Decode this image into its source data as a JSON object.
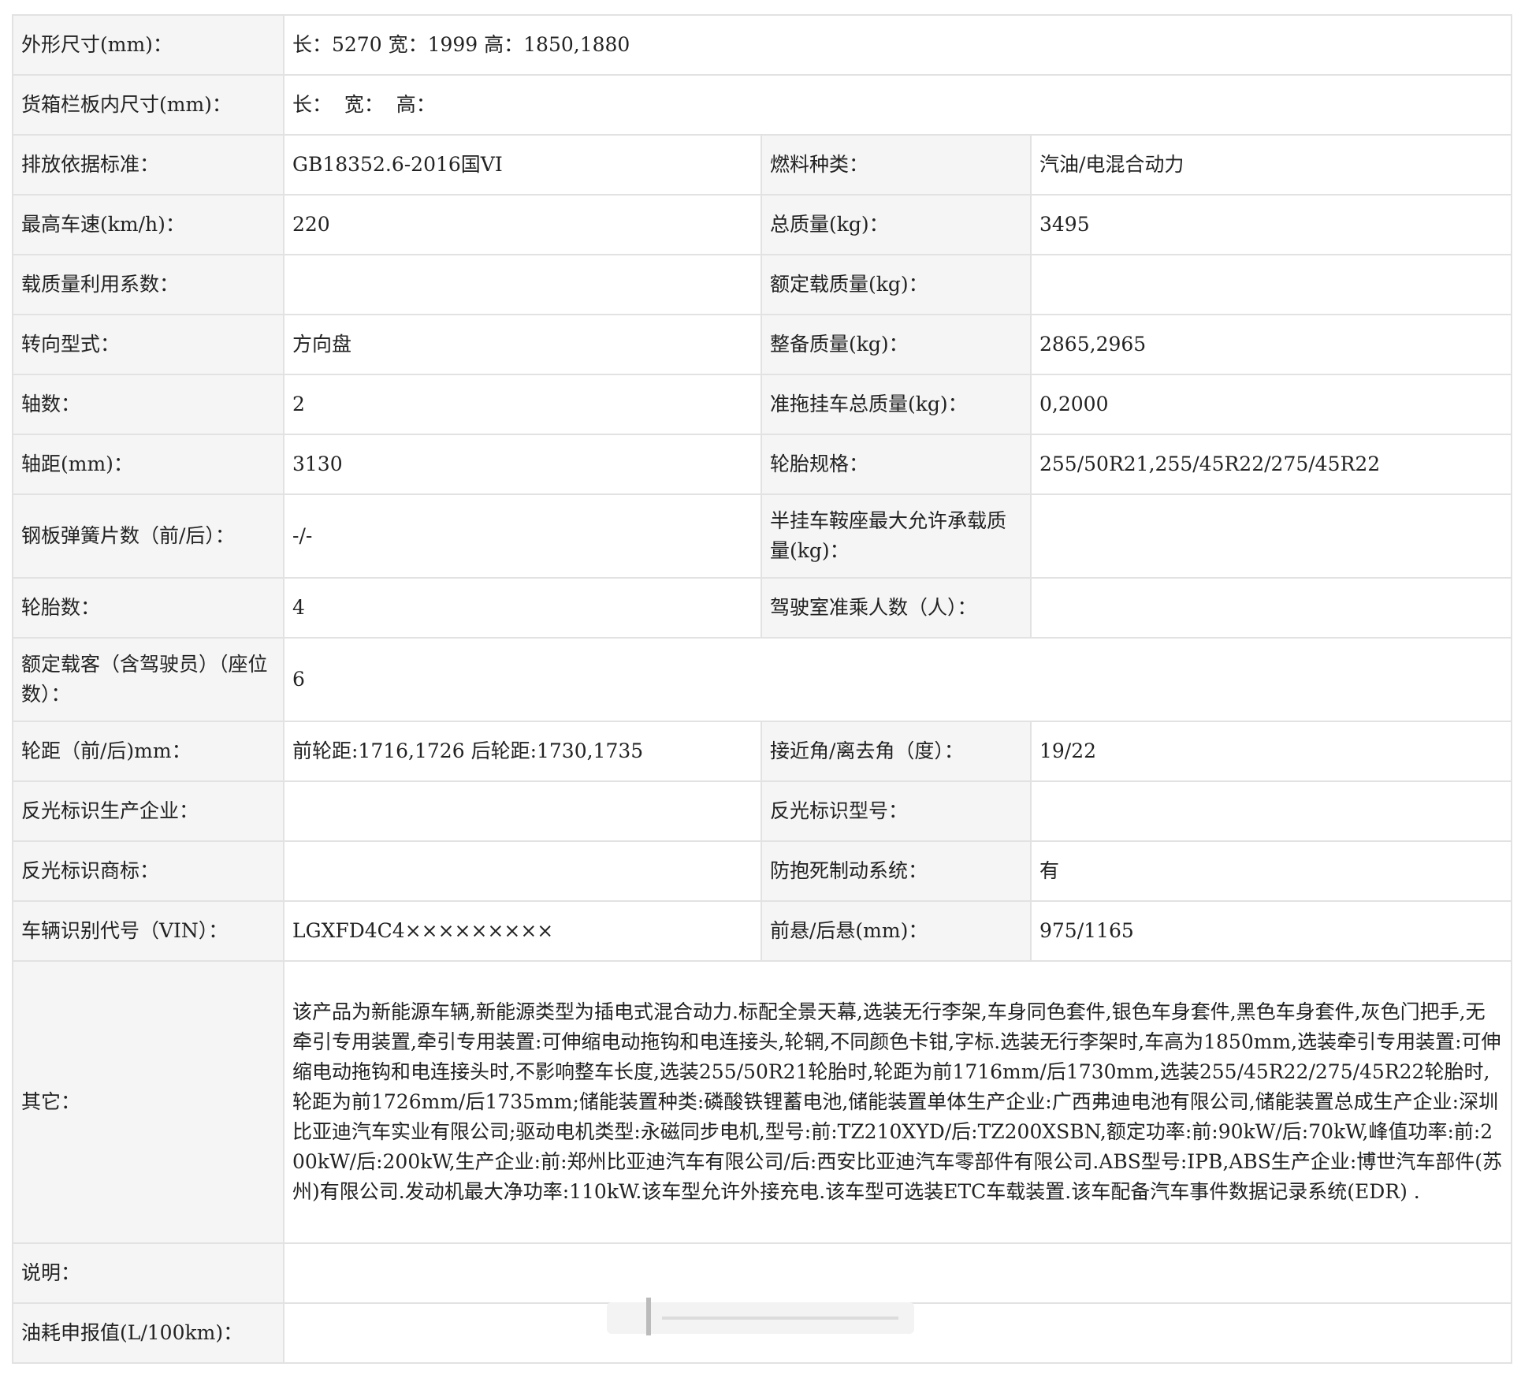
{
  "rows": [
    {
      "l1": "外形尺寸(mm)：",
      "v1": "长：5270 宽：1999 高：1850,1880"
    },
    {
      "l1": "货箱栏板内尺寸(mm)：",
      "v1": "长：  宽：  高："
    },
    {
      "l1": "排放依据标准：",
      "v1": "GB18352.6-2016国VI",
      "l2": "燃料种类：",
      "v2": "汽油/电混合动力"
    },
    {
      "l1": "最高车速(km/h)：",
      "v1": "220",
      "l2": "总质量(kg)：",
      "v2": "3495"
    },
    {
      "l1": "载质量利用系数：",
      "v1": "",
      "l2": "额定载质量(kg)：",
      "v2": ""
    },
    {
      "l1": "转向型式：",
      "v1": "方向盘",
      "l2": "整备质量(kg)：",
      "v2": "2865,2965"
    },
    {
      "l1": "轴数：",
      "v1": "2",
      "l2": "准拖挂车总质量(kg)：",
      "v2": "0,2000"
    },
    {
      "l1": "轴距(mm)：",
      "v1": "3130",
      "l2": "轮胎规格：",
      "v2": "255/50R21,255/45R22/275/45R22"
    },
    {
      "l1": "钢板弹簧片数（前/后）：",
      "v1": "-/-",
      "l2": "半挂车鞍座最大允许承载质量(kg)：",
      "v2": ""
    },
    {
      "l1": "轮胎数：",
      "v1": "4",
      "l2": "驾驶室准乘人数（人）：",
      "v2": ""
    },
    {
      "l1": "额定载客（含驾驶员）（座位数）：",
      "v1": "6"
    },
    {
      "l1": "轮距（前/后)mm：",
      "v1": "前轮距:1716,1726 后轮距:1730,1735",
      "l2": "接近角/离去角（度）：",
      "v2": "19/22"
    },
    {
      "l1": "反光标识生产企业：",
      "v1": "",
      "l2": "反光标识型号：",
      "v2": ""
    },
    {
      "l1": "反光标识商标：",
      "v1": "",
      "l2": "防抱死制动系统：",
      "v2": "有"
    },
    {
      "l1": "车辆识别代号（VIN）：",
      "v1": "LGXFD4C4×××××××××",
      "l2": "前悬/后悬(mm)：",
      "v2": "975/1165"
    },
    {
      "l1": "其它：",
      "v1": "该产品为新能源车辆,新能源类型为插电式混合动力.标配全景天幕,选装无行李架,车身同色套件,银色车身套件,黑色车身套件,灰色门把手,无牵引专用装置,牵引专用装置:可伸缩电动拖钩和电连接头,轮辋,不同颜色卡钳,字标.选装无行李架时,车高为1850mm,选装牵引专用装置:可伸缩电动拖钩和电连接头时,不影响整车长度,选装255/50R21轮胎时,轮距为前1716mm/后1730mm,选装255/45R22/275/45R22轮胎时,轮距为前1726mm/后1735mm;储能装置种类:磷酸铁锂蓄电池,储能装置单体生产企业:广西弗迪电池有限公司,储能装置总成生产企业:深圳比亚迪汽车实业有限公司;驱动电机类型:永磁同步电机,型号:前:TZ210XYD/后:TZ200XSBN,额定功率:前:90kW/后:70kW,峰值功率:前:200kW/后:200kW,生产企业:前:郑州比亚迪汽车有限公司/后:西安比亚迪汽车零部件有限公司.ABS型号:IPB,ABS生产企业:博世汽车部件(苏州)有限公司.发动机最大净功率:110kW.该车型允许外接充电.该车型可选装ETC车载装置.该车配备汽车事件数据记录系统(EDR) ."
    },
    {
      "l1": "说明：",
      "v1": ""
    },
    {
      "l1": "油耗申报值(L/100km)：",
      "v1": ""
    }
  ]
}
